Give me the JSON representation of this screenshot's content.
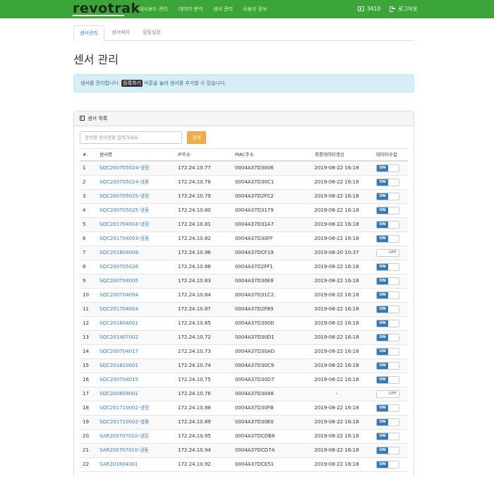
{
  "navbar": {
    "brand": "revotrak",
    "menu": [
      "대시보드 관리",
      "데이터 분석",
      "센서 관리",
      "사용자 정보"
    ],
    "user_id": "3410",
    "logout": "로그아웃"
  },
  "tabs": [
    "센서관리",
    "센서배치",
    "알림설정"
  ],
  "page_title": "센서 관리",
  "alert": {
    "before": "센서를 관리합니다.",
    "kbd": "등록하기",
    "after": "버튼을 눌러 센서를 추가할 수 있습니다."
  },
  "panel": {
    "title": "센서 목록",
    "search_placeholder": "검색할 센서명을 입력하세요",
    "search_button": "검색"
  },
  "table": {
    "headers": [
      "#.",
      "센서명",
      "IP주소",
      "MAC주소",
      "최종데이터갱신",
      "데이터수집"
    ],
    "toggle_on": "ON",
    "toggle_off": "OFF",
    "rows": [
      {
        "no": "1",
        "name": "SQC200705024-냉장",
        "ip": "172.24.10.77",
        "mac": "0004A37D3006",
        "updated": "2019-08-22 16:18",
        "collect": "on"
      },
      {
        "no": "2",
        "name": "SQC200705024-냉동",
        "ip": "172.24.10.78",
        "mac": "0004A37D30C1",
        "updated": "2019-08-22 16:18",
        "collect": "on"
      },
      {
        "no": "3",
        "name": "SQC200705025-냉장",
        "ip": "172.24.10.79",
        "mac": "0004A37D2FC2",
        "updated": "2019-08-22 16:18",
        "collect": "on"
      },
      {
        "no": "4",
        "name": "SQC200705025-냉동",
        "ip": "172.24.10.80",
        "mac": "0004A37D3179",
        "updated": "2019-08-22 16:18",
        "collect": "on"
      },
      {
        "no": "5",
        "name": "SQC201704003-냉장",
        "ip": "172.24.10.81",
        "mac": "0004A37D31A7",
        "updated": "2019-08-22 16:18",
        "collect": "on"
      },
      {
        "no": "6",
        "name": "SQC201704003-냉동",
        "ip": "172.24.10.82",
        "mac": "0004A37D30FF",
        "updated": "2019-08-22 16:18",
        "collect": "on"
      },
      {
        "no": "7",
        "name": "SQC201804009",
        "ip": "172.24.10.96",
        "mac": "0004A37DCF19",
        "updated": "2019-08-20 10:37",
        "collect": "off"
      },
      {
        "no": "8",
        "name": "SQC200705026",
        "ip": "172.24.10.86",
        "mac": "0004A37D2FF1",
        "updated": "2019-08-22 16:18",
        "collect": "on"
      },
      {
        "no": "9",
        "name": "SQC200704005",
        "ip": "172.24.10.83",
        "mac": "0004A37D30E8",
        "updated": "2019-08-22 16:18",
        "collect": "on"
      },
      {
        "no": "10",
        "name": "SQC200704004",
        "ip": "172.24.10.84",
        "mac": "0004A37D31C2",
        "updated": "2019-08-22 16:18",
        "collect": "on"
      },
      {
        "no": "11",
        "name": "SQC201704004",
        "ip": "172.24.10.87",
        "mac": "0004A37D2F89",
        "updated": "2019-08-22 16:18",
        "collect": "on"
      },
      {
        "no": "12",
        "name": "SQC201604001",
        "ip": "172.24.10.85",
        "mac": "0004A37D300D",
        "updated": "2019-08-22 16:18",
        "collect": "on"
      },
      {
        "no": "13",
        "name": "SQC201407002",
        "ip": "172.24.10.72",
        "mac": "0004A37D30D1",
        "updated": "2019-08-22 16:18",
        "collect": "on"
      },
      {
        "no": "14",
        "name": "SQC200704017",
        "ip": "172.24.10.73",
        "mac": "0004A37D30AD",
        "updated": "2019-08-22 16:18",
        "collect": "on"
      },
      {
        "no": "15",
        "name": "SQC201610001",
        "ip": "172.24.10.74",
        "mac": "0004A37D30C9",
        "updated": "2019-08-22 16:18",
        "collect": "on"
      },
      {
        "no": "16",
        "name": "SQC200704015",
        "ip": "172.24.10.75",
        "mac": "0004A37D30D7",
        "updated": "2019-08-22 16:18",
        "collect": "on"
      },
      {
        "no": "17",
        "name": "SQC200809001",
        "ip": "172.24.10.76",
        "mac": "0004A37D3048",
        "updated": "-",
        "collect": "off"
      },
      {
        "no": "18",
        "name": "SQC201710002-냉장",
        "ip": "172.24.10.88",
        "mac": "0004A37D30FB",
        "updated": "2019-08-22 16:18",
        "collect": "on"
      },
      {
        "no": "19",
        "name": "SQC201710002-냉동",
        "ip": "172.24.10.89",
        "mac": "0004A37D30E0",
        "updated": "2019-08-22 16:18",
        "collect": "on"
      },
      {
        "no": "20",
        "name": "SAR200707010-냉장",
        "ip": "172.24.10.95",
        "mac": "0004A37DCDB8",
        "updated": "2019-08-22 16:18",
        "collect": "on"
      },
      {
        "no": "21",
        "name": "SAR200707010-냉동",
        "ip": "172.24.10.94",
        "mac": "0004A37DCD7A",
        "updated": "2019-08-22 16:18",
        "collect": "on"
      },
      {
        "no": "22",
        "name": "SAR201804001",
        "ip": "172.24.10.92",
        "mac": "0004A37DCE51",
        "updated": "2019-08-22 16:18",
        "collect": "on"
      }
    ]
  }
}
